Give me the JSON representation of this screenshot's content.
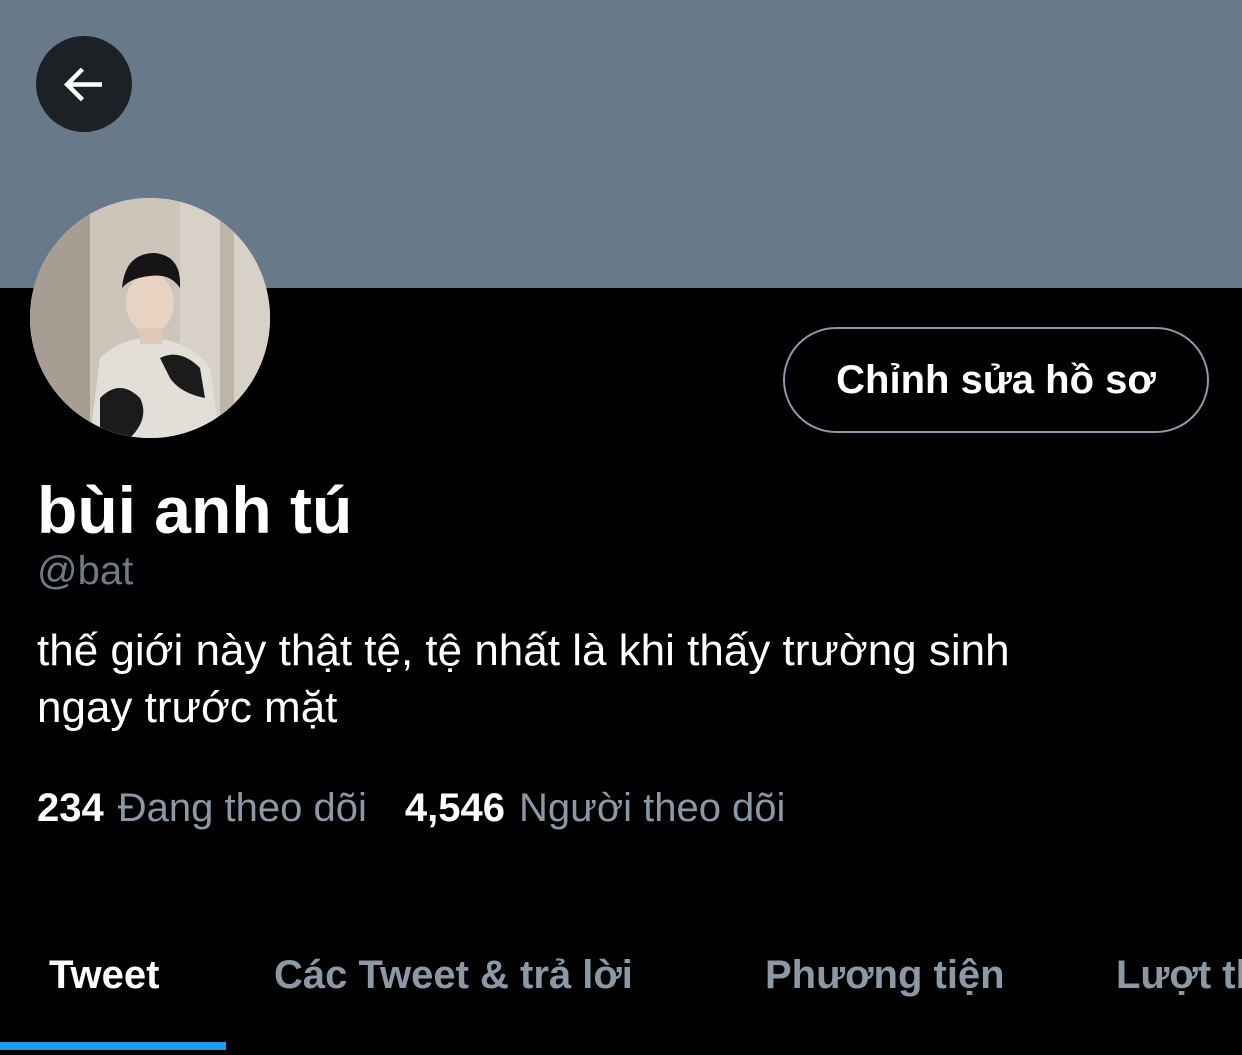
{
  "header": {
    "back_icon": "arrow-left-icon",
    "banner_color": "#687989"
  },
  "profile": {
    "display_name": "bùi anh tú",
    "handle": "@bat",
    "bio_line1": "thế giới này thật tệ, tệ nhất là khi thấy trường sinh",
    "bio_line2": "ngay trước mặt",
    "edit_label": "Chỉnh sửa hồ sơ"
  },
  "stats": {
    "following_count": "234",
    "following_label": "Đang theo dõi",
    "followers_count": "4,546",
    "followers_label": "Người theo dõi"
  },
  "tabs": [
    {
      "label": "Tweet",
      "active": true
    },
    {
      "label": "Các Tweet & trả lời",
      "active": false
    },
    {
      "label": "Phương tiện",
      "active": false
    },
    {
      "label": "Lượt thích",
      "active": false
    }
  ],
  "colors": {
    "accent": "#1d9bf0",
    "muted_text": "#8b98a5"
  }
}
